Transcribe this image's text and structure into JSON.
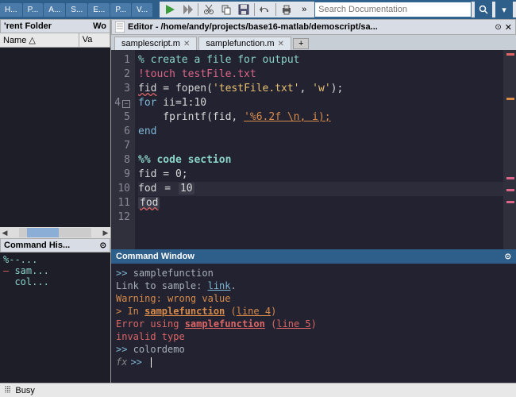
{
  "menu": {
    "items": [
      "H...",
      "P...",
      "A...",
      "S...",
      "E...",
      "P...",
      "V..."
    ]
  },
  "search": {
    "placeholder": "Search Documentation"
  },
  "folder": {
    "title": "'rent Folder",
    "right": "Wo",
    "cols": [
      "Name △",
      "Va"
    ]
  },
  "history": {
    "title": "Command His...",
    "lines": [
      {
        "text": "%--...",
        "red": false
      },
      {
        "text": "sam...",
        "red": true
      },
      {
        "text": "col...",
        "red": false
      }
    ]
  },
  "editor": {
    "title": "Editor - /home/andy/projects/base16-matlab/demoscript/sa...",
    "tabs": [
      {
        "label": "samplescript.m"
      },
      {
        "label": "samplefunction.m"
      }
    ],
    "lines": [
      "1",
      "2",
      "3",
      "4",
      "5",
      "6",
      "7",
      "8",
      "9",
      "10",
      "11",
      "12"
    ],
    "code": {
      "l1": "% create a file for output",
      "l2": "!touch testFile.txt",
      "l3a": "fid",
      "l3b": " = fopen(",
      "l3c": "'testFile.txt'",
      "l3d": ", ",
      "l3e": "'w'",
      "l3f": ");",
      "l4a": "for",
      "l4b": " ii=1:10",
      "l5a": "    fprintf(fid, ",
      "l5b": "'%6.2f \\n, i);",
      "l6": "end",
      "l8": "%% code section",
      "l9": "fid = 0;",
      "l10a": "fod",
      "l10b": " = ",
      "l10c": "10",
      "l11": "fod"
    }
  },
  "cmdwin": {
    "title": "Command Window",
    "l1a": ">> ",
    "l1b": "samplefunction",
    "l2a": "Link to sample: ",
    "l2b": "link",
    "l2c": ".",
    "l3": "Warning: wrong value",
    "l4a": "> In ",
    "l4b": "samplefunction",
    "l4c": " (",
    "l4d": "line 4",
    "l4e": ")",
    "l5a": "Error using ",
    "l5b": "samplefunction",
    "l5c": " (",
    "l5d": "line 5",
    "l5e": ")",
    "l6": "invalid type",
    "l7a": ">> ",
    "l7b": "colordemo",
    "fx": "fx"
  },
  "status": {
    "text": "Busy"
  },
  "colors": {
    "red": "#d66",
    "orange": "#d98c4a",
    "teal": "#8bd4c9",
    "pink": "#d68"
  }
}
